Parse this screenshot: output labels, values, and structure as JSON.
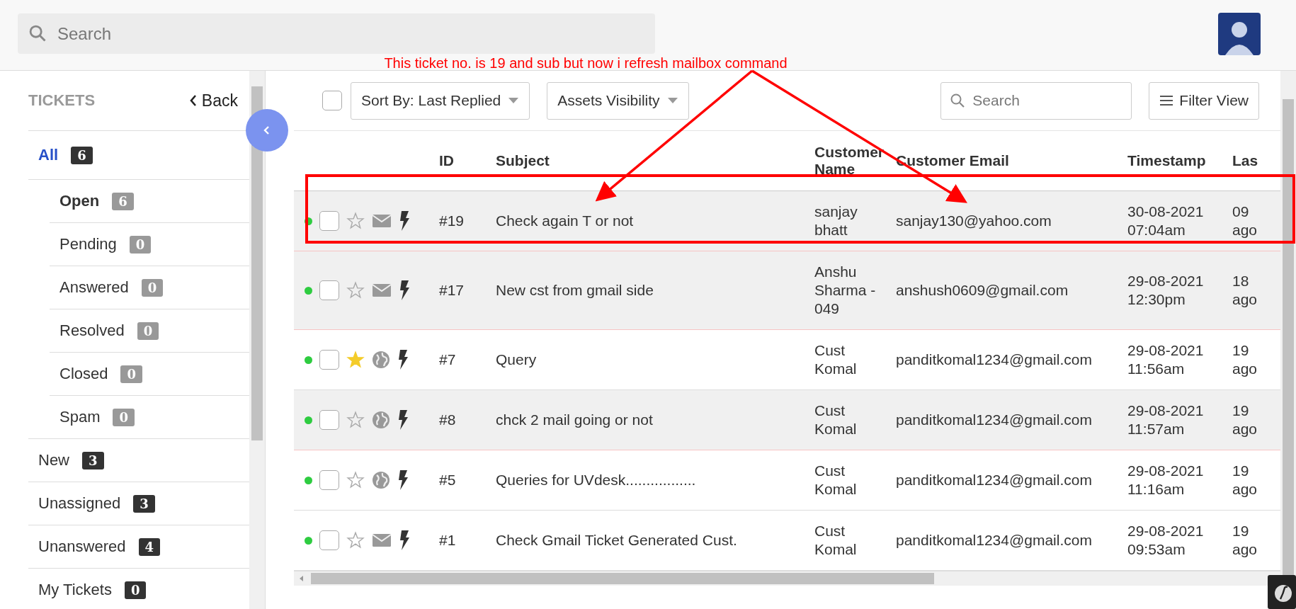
{
  "top_search": {
    "placeholder": "Search"
  },
  "sidebar": {
    "title": "TICKETS",
    "back": "Back",
    "items": [
      {
        "label": "All",
        "count": "6",
        "selected": true,
        "children": [
          {
            "label": "Open",
            "count": "6",
            "selected": true
          },
          {
            "label": "Pending",
            "count": "0",
            "selected": false
          },
          {
            "label": "Answered",
            "count": "0",
            "selected": false
          },
          {
            "label": "Resolved",
            "count": "0",
            "selected": false
          },
          {
            "label": "Closed",
            "count": "0",
            "selected": false
          },
          {
            "label": "Spam",
            "count": "0",
            "selected": false
          }
        ]
      },
      {
        "label": "New",
        "count": "3",
        "selected": false
      },
      {
        "label": "Unassigned",
        "count": "3",
        "selected": false
      },
      {
        "label": "Unanswered",
        "count": "4",
        "selected": false
      },
      {
        "label": "My Tickets",
        "count": "0",
        "selected": false
      }
    ]
  },
  "toolbar": {
    "select_all": {
      "checked": false
    },
    "sort": "Sort By: Last Replied",
    "assets": "Assets Visibility",
    "search": {
      "placeholder": "Search"
    },
    "filter": "Filter View"
  },
  "table": {
    "columns": [
      "ID",
      "Subject",
      "Customer Name",
      "Customer Email",
      "Timestamp",
      "Las"
    ],
    "rows": [
      {
        "color": "#2ecc40",
        "checked": false,
        "starred": false,
        "email_source": true,
        "unread": true,
        "id": "#19",
        "subject": "Check again T or not",
        "customer_name": "sanjay bhatt",
        "email": "sanjay130@yahoo.com",
        "timestamp": "30-08-2021 07:04am",
        "last_replied": "09 ago"
      },
      {
        "color": "#2ecc40",
        "checked": false,
        "starred": false,
        "email_source": true,
        "unread": true,
        "id": "#17",
        "subject": "New cst from gmail side",
        "customer_name": "Anshu Sharma - 049",
        "email": "anshush0609@gmail.com",
        "timestamp": "29-08-2021 12:30pm",
        "last_replied": "18 ago"
      },
      {
        "color": "#2ecc40",
        "checked": false,
        "starred": true,
        "email_source": false,
        "unread": false,
        "id": "#7",
        "subject": "Query",
        "customer_name": "Cust Komal",
        "email": "panditkomal1234@gmail.com",
        "timestamp": "29-08-2021 11:56am",
        "last_replied": "19 ago"
      },
      {
        "color": "#2ecc40",
        "checked": false,
        "starred": false,
        "email_source": false,
        "unread": true,
        "id": "#8",
        "subject": "chck 2 mail going or not",
        "customer_name": "Cust Komal",
        "email": "panditkomal1234@gmail.com",
        "timestamp": "29-08-2021 11:57am",
        "last_replied": "19 ago"
      },
      {
        "color": "#2ecc40",
        "checked": false,
        "starred": false,
        "email_source": false,
        "unread": false,
        "id": "#5",
        "subject": "Queries for UVdesk.................",
        "customer_name": "Cust Komal",
        "email": "panditkomal1234@gmail.com",
        "timestamp": "29-08-2021 11:16am",
        "last_replied": "19 ago"
      },
      {
        "color": "#2ecc40",
        "checked": false,
        "starred": false,
        "email_source": true,
        "unread": false,
        "id": "#1",
        "subject": "Check Gmail Ticket Generated Cust.",
        "customer_name": "Cust Komal",
        "email": "panditkomal1234@gmail.com",
        "timestamp": "29-08-2021 09:53am",
        "last_replied": "19 ago"
      }
    ]
  },
  "annotation": {
    "text": "This ticket no. is 19 and sub but now i refresh mailbox command"
  }
}
